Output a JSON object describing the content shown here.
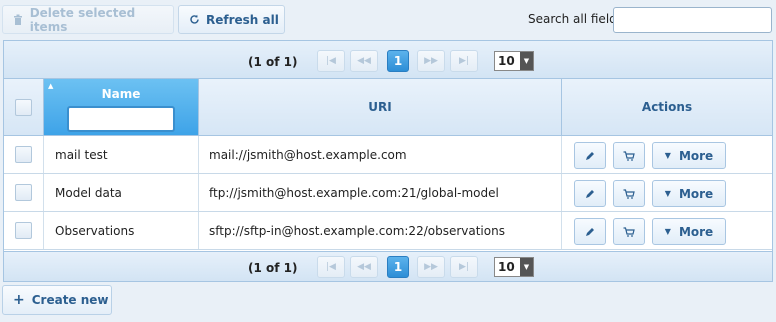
{
  "toolbar": {
    "delete_label": "Delete selected items",
    "refresh_label": "Refresh all",
    "search_label": "Search all fields:",
    "search_value": ""
  },
  "pager": {
    "page_count": "(1 of 1)",
    "current_page": "1",
    "rows_per_page": "10"
  },
  "table": {
    "columns": {
      "name": "Name",
      "uri": "URI",
      "actions": "Actions"
    },
    "name_filter_value": "",
    "rows": [
      {
        "name": "mail test",
        "uri": "mail://jsmith@host.example.com",
        "more_label": "More"
      },
      {
        "name": "Model data",
        "uri": "ftp://jsmith@host.example.com:21/global-model",
        "more_label": "More"
      },
      {
        "name": "Observations",
        "uri": "sftp://sftp-in@host.example.com:22/observations",
        "more_label": "More"
      }
    ]
  },
  "footer": {
    "create_label": "Create new"
  },
  "icons": {
    "delete": "trash-icon",
    "refresh": "refresh-icon",
    "edit": "pencil-icon",
    "cart": "cart-icon",
    "more": "triangle-down-icon",
    "create": "plus-icon"
  },
  "colors": {
    "accent": "#2c5f90",
    "active_page": "#3a9be3",
    "header_highlight": "#55b3ee",
    "border": "#a6c5e2"
  }
}
